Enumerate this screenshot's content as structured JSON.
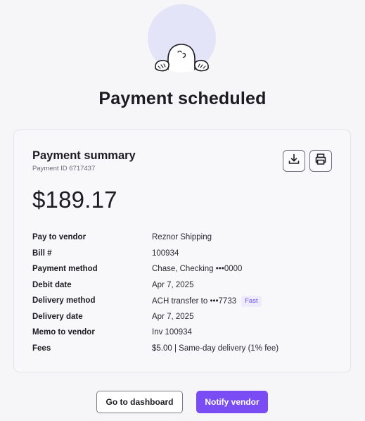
{
  "page": {
    "title": "Payment scheduled"
  },
  "summary": {
    "title": "Payment summary",
    "payment_id": "Payment ID 6717437",
    "amount": "$189.17",
    "download_icon": "download-icon",
    "print_icon": "printer-icon",
    "rows": [
      {
        "label": "Pay to vendor",
        "value": "Reznor Shipping"
      },
      {
        "label": "Bill #",
        "value": "100934"
      },
      {
        "label": "Payment method",
        "value": "Chase, Checking •••0000"
      },
      {
        "label": "Debit date",
        "value": "Apr 7, 2025"
      },
      {
        "label": "Delivery method",
        "value": "ACH transfer to •••7733",
        "badge": "Fast"
      },
      {
        "label": "Delivery date",
        "value": "Apr 7, 2025"
      },
      {
        "label": "Memo to vendor",
        "value": "Inv 100934"
      },
      {
        "label": "Fees",
        "value": "$5.00 | Same-day delivery (1% fee)"
      }
    ]
  },
  "actions": {
    "dashboard_label": "Go to dashboard",
    "notify_label": "Notify vendor"
  },
  "colors": {
    "accent": "#7a4cf4",
    "illustration_bg": "#e3e4f7",
    "badge_bg": "#eeebfd",
    "badge_text": "#6b4fe0"
  }
}
